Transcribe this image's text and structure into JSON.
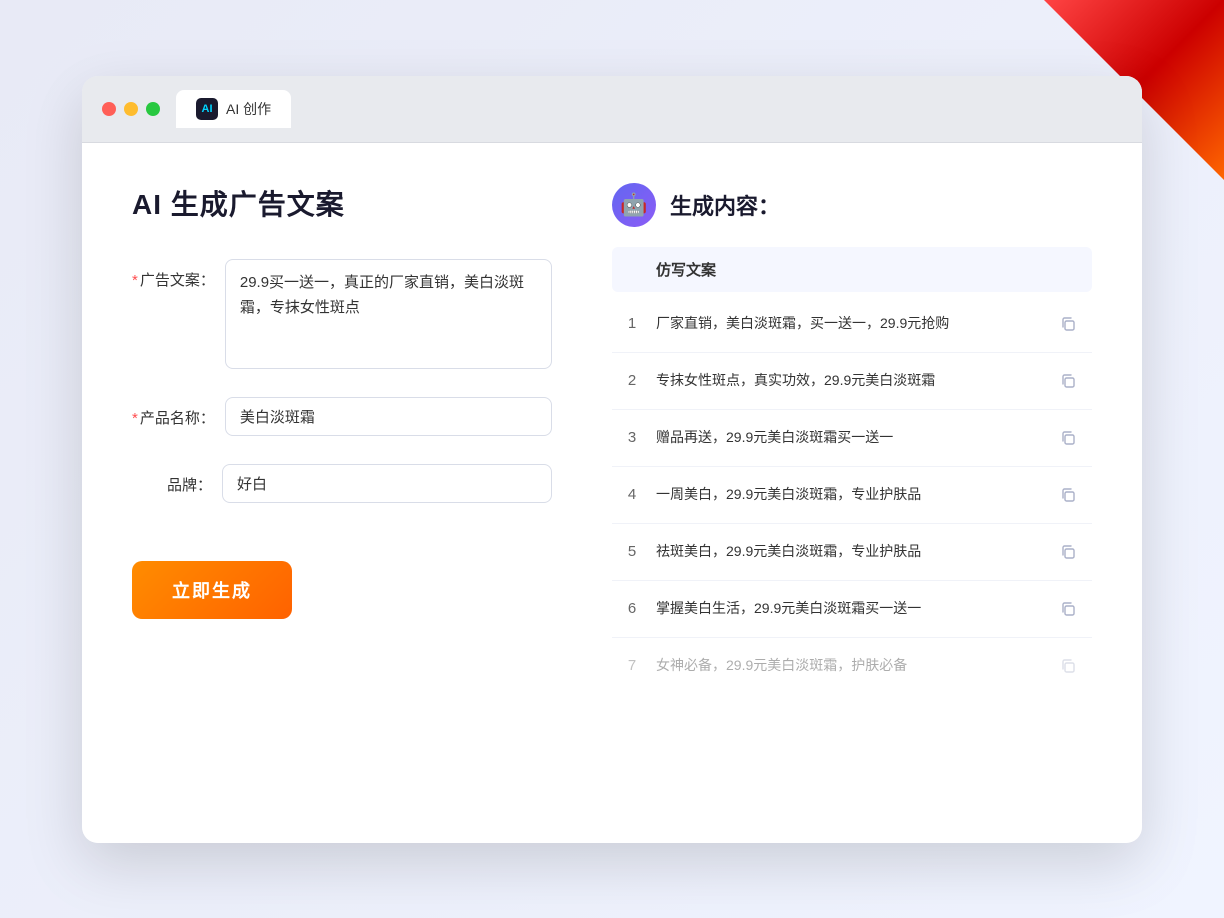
{
  "window": {
    "tab_icon_text": "AI",
    "tab_title": "AI 创作"
  },
  "page": {
    "title": "AI 生成广告文案",
    "generate_label": "立即生成"
  },
  "form": {
    "ad_copy_label": "广告文案：",
    "ad_copy_required": "✱",
    "ad_copy_value": "29.9买一送一，真正的厂家直销，美白淡斑霜，专抹女性斑点",
    "product_name_label": "产品名称：",
    "product_name_required": "✱",
    "product_name_value": "美白淡斑霜",
    "brand_label": "品牌：",
    "brand_value": "好白"
  },
  "results": {
    "header_icon": "🤖",
    "header_title": "生成内容：",
    "table_header": "仿写文案",
    "items": [
      {
        "num": "1",
        "text": "厂家直销，美白淡斑霜，买一送一，29.9元抢购"
      },
      {
        "num": "2",
        "text": "专抹女性斑点，真实功效，29.9元美白淡斑霜"
      },
      {
        "num": "3",
        "text": "赠品再送，29.9元美白淡斑霜买一送一"
      },
      {
        "num": "4",
        "text": "一周美白，29.9元美白淡斑霜，专业护肤品"
      },
      {
        "num": "5",
        "text": "祛斑美白，29.9元美白淡斑霜，专业护肤品"
      },
      {
        "num": "6",
        "text": "掌握美白生活，29.9元美白淡斑霜买一送一"
      },
      {
        "num": "7",
        "text": "女神必备，29.9元美白淡斑霜，护肤必备",
        "faded": true
      }
    ]
  }
}
